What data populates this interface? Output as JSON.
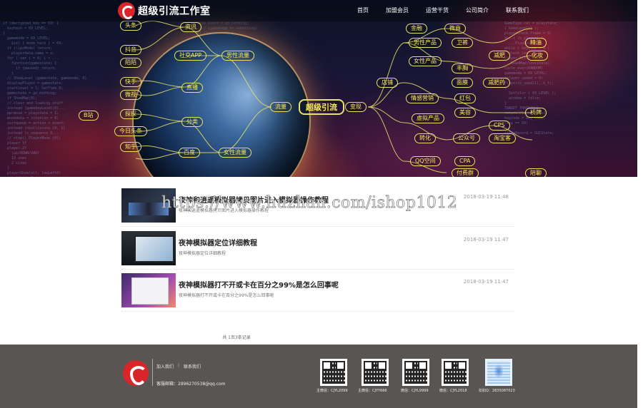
{
  "brand": {
    "name": "超级引流工作室"
  },
  "nav": {
    "items": [
      "首页",
      "加盟会员",
      "运营干货",
      "公司简介",
      "联系我们"
    ]
  },
  "mindmap": {
    "center": "超级引流",
    "left_nodes": [
      "头条",
      "资讯",
      "社交APP",
      "男性流量",
      "陌陌",
      "直播",
      "快手",
      "分类",
      "百度",
      "女性流量",
      "流量",
      "变现",
      "抖音",
      "微视",
      "探探",
      "B站",
      "知乎",
      "今日头条"
    ],
    "right_nodes": [
      "金融",
      "微商",
      "店铺",
      "男性产品",
      "卫裤",
      "精油",
      "女性产品",
      "丰胸",
      "减肥",
      "面膜",
      "情感营销",
      "红包",
      "美容",
      "化妆",
      "减肥药",
      "虚拟产品",
      "公众号",
      "CPA",
      "QQ空间",
      "付费群",
      "CPS",
      "淘宝客",
      "转化",
      "陪聊",
      "桥牌"
    ]
  },
  "articles": [
    {
      "title": "夜神和逍遥模拟器拷贝图片进入模拟器操作教程",
      "date": "2018-03-19 11:48",
      "summary": "夜神和逍遥模拟器拷贝图片进入模拟器操作教程",
      "thumb": "emulator-desktop"
    },
    {
      "title": "夜神模拟器定位详细教程",
      "date": "2018-03-19 11:47",
      "summary": "夜神模拟器定位详细教程",
      "thumb": "emulator-map"
    },
    {
      "title": "夜神模拟器打不开或卡在百分之99%是怎么回事呢",
      "date": "2018-03-19 11:47",
      "summary": "夜神模拟器打不开或卡在百分之99%是怎么回事呢",
      "thumb": "emulator-loading"
    }
  ],
  "pagination": {
    "text": "共 1页3条记录"
  },
  "watermark": "https://www.huzhan.com/ishop1012",
  "footer": {
    "links": [
      "加入我们",
      "|",
      "联系我们"
    ],
    "email": "客服邮箱：2896270538@qq.com",
    "qrcodes": [
      {
        "label": "主微信：CJYL2099"
      },
      {
        "label": "主微信：CJYY666"
      },
      {
        "label": "微信：CJYL9999"
      },
      {
        "label": "微信：CJYL2018"
      },
      {
        "label": "扣扣Q：2835087023"
      }
    ]
  },
  "colors": {
    "brand_red": "#d9252a",
    "mindmap_yellow": "#f5ec5a",
    "footer_bg": "#585553"
  }
}
